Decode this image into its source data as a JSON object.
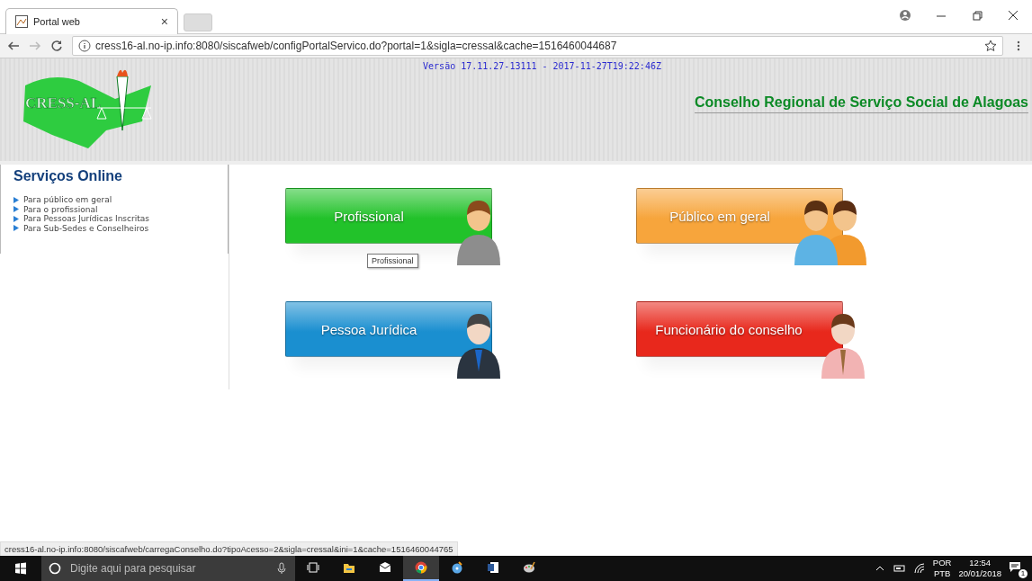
{
  "browser": {
    "tab": {
      "title": "Portal web",
      "close": "×"
    },
    "url": "cress16-al.no-ip.info:8080/siscafweb/configPortalServico.do?portal=1&sigla=cressal&cache=1516460044687"
  },
  "header": {
    "logo_text": "CRESS-AL",
    "version": "Versão 17.11.27-13111 - 2017-11-27T19:22:46Z",
    "title": "Conselho Regional de Serviço Social de Alagoas"
  },
  "sidebar": {
    "title": "Serviços Online",
    "items": [
      {
        "label": "Para público em geral"
      },
      {
        "label": "Para o profissional"
      },
      {
        "label": "Para Pessoas Jurídicas Inscritas"
      },
      {
        "label": "Para Sub-Sedes e Conselheiros"
      }
    ]
  },
  "tiles": [
    {
      "label": "Profissional",
      "color": "#22c22a",
      "kind": "single",
      "tooltip": "Profissional"
    },
    {
      "label": "Público em geral",
      "color": "#f7a53c",
      "kind": "pair"
    },
    {
      "label": "Pessoa Jurídica",
      "color": "#1a8fd0",
      "kind": "suit"
    },
    {
      "label": "Funcionário do conselho",
      "color": "#e8281c",
      "kind": "shirt"
    }
  ],
  "status_url": "cress16-al.no-ip.info:8080/siscafweb/carregaConselho.do?tipoAcesso=2&sigla=cressal&ini=1&cache=1516460044765",
  "taskbar": {
    "search": {
      "placeholder": "Digite aqui para pesquisar"
    },
    "apps": [
      {
        "kind": "taskview",
        "selected": false
      },
      {
        "kind": "folder",
        "selected": false
      },
      {
        "kind": "mail",
        "selected": false
      },
      {
        "kind": "browser",
        "selected": true
      },
      {
        "kind": "disc",
        "selected": false
      },
      {
        "kind": "document",
        "selected": false
      },
      {
        "kind": "palette",
        "selected": false
      }
    ],
    "language": [
      "POR",
      "PTB"
    ],
    "time": "12:54",
    "date": "20/01/2018",
    "notification_count": "1"
  }
}
